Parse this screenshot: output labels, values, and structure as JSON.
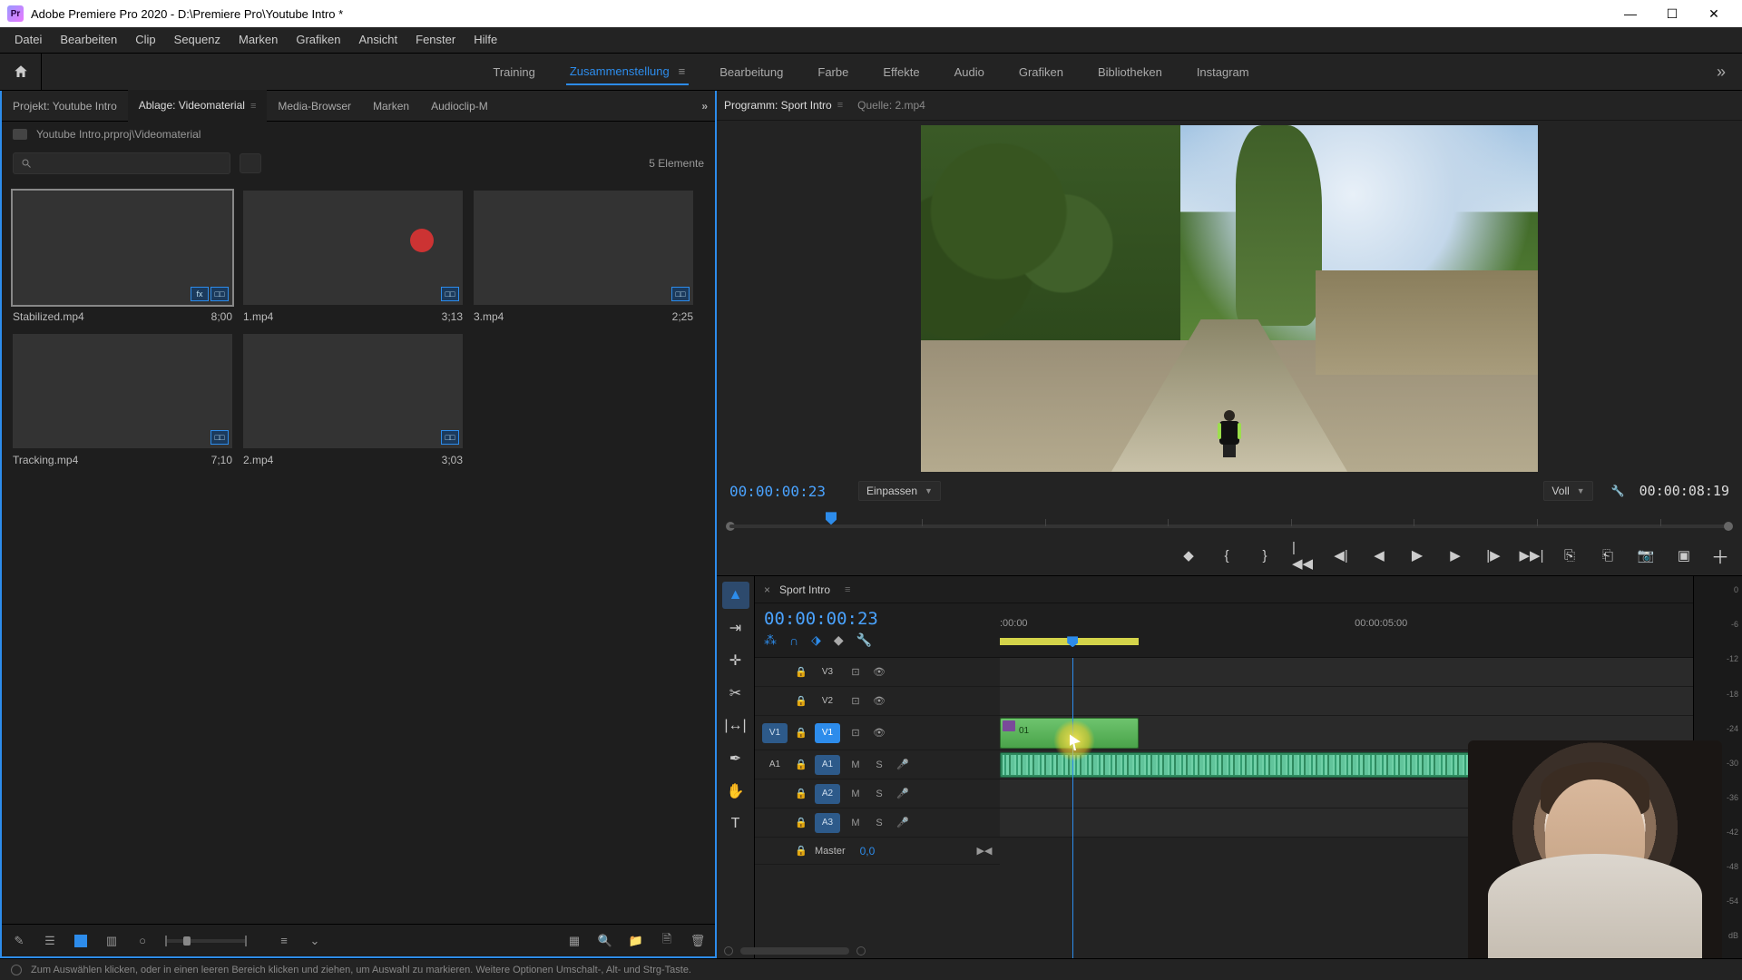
{
  "app": {
    "title": "Adobe Premiere Pro 2020 - D:\\Premiere Pro\\Youtube Intro *"
  },
  "menu": [
    "Datei",
    "Bearbeiten",
    "Clip",
    "Sequenz",
    "Marken",
    "Grafiken",
    "Ansicht",
    "Fenster",
    "Hilfe"
  ],
  "workspaces": {
    "items": [
      "Training",
      "Zusammenstellung",
      "Bearbeitung",
      "Farbe",
      "Effekte",
      "Audio",
      "Grafiken",
      "Bibliotheken",
      "Instagram"
    ],
    "active": 1,
    "more": "»"
  },
  "project": {
    "tabs": {
      "items": [
        "Projekt: Youtube Intro",
        "Ablage: Videomaterial",
        "Media-Browser",
        "Marken",
        "Audioclip-M"
      ],
      "active": 1,
      "overflow": "»"
    },
    "breadcrumb": "Youtube Intro.prproj\\Videomaterial",
    "item_count_label": "5 Elemente",
    "clips": [
      {
        "name": "Stabilized.mp4",
        "dur": "8;00",
        "sel": true,
        "badges": [
          "fx",
          "□□"
        ],
        "img": "img-path"
      },
      {
        "name": "1.mp4",
        "dur": "3;13",
        "sel": false,
        "badges": [
          "□□"
        ],
        "img": "img-wall"
      },
      {
        "name": "3.mp4",
        "dur": "2;25",
        "sel": false,
        "badges": [
          "□□"
        ],
        "img": "img-ground"
      },
      {
        "name": "Tracking.mp4",
        "dur": "7;10",
        "sel": false,
        "badges": [
          "□□"
        ],
        "img": "img-field"
      },
      {
        "name": "2.mp4",
        "dur": "3;03",
        "sel": false,
        "badges": [
          "□□"
        ],
        "img": "img-runner"
      }
    ]
  },
  "program": {
    "tab_label": "Programm: Sport Intro",
    "source_label": "Quelle: 2.mp4",
    "timecode": "00:00:00:23",
    "zoom_label": "Einpassen",
    "quality_label": "Voll",
    "duration": "00:00:08:19"
  },
  "timeline": {
    "seq_name": "Sport Intro",
    "timecode": "00:00:00:23",
    "ruler_labels": [
      {
        "t": ":00:00",
        "x_pct": 2
      },
      {
        "t": "00:00:05:00",
        "x_pct": 55
      }
    ],
    "work_area": {
      "left_pct": 0,
      "width_pct": 20
    },
    "playhead_pct": 10.5,
    "tracks": {
      "video": [
        {
          "src": "",
          "name": "V3",
          "eye": true
        },
        {
          "src": "",
          "name": "V2",
          "eye": true
        },
        {
          "src": "V1",
          "src_on": true,
          "name": "V1",
          "name_on": true,
          "eye": true
        }
      ],
      "audio": [
        {
          "src": "A1",
          "name": "A1",
          "name_on": true,
          "m": "M",
          "s": "S"
        },
        {
          "src": "",
          "name": "A2",
          "name_on": true,
          "m": "M",
          "s": "S"
        },
        {
          "src": "",
          "name": "A3",
          "name_on": true,
          "m": "M",
          "s": "S"
        }
      ],
      "master": {
        "label": "Master",
        "value": "0,0"
      }
    },
    "clips": {
      "video": {
        "left_pct": 0,
        "width_pct": 20,
        "label": "01"
      },
      "audio": {
        "left_pct": 0,
        "width_pct": 84
      }
    }
  },
  "meters": {
    "scale": [
      "0",
      "-6",
      "-12",
      "-18",
      "-24",
      "-30",
      "-36",
      "-42",
      "-48",
      "-54",
      "dB"
    ]
  },
  "status": {
    "text": "Zum Auswählen klicken, oder in einen leeren Bereich klicken und ziehen, um Auswahl zu markieren. Weitere Optionen Umschalt-, Alt- und Strg-Taste."
  },
  "colors": {
    "accent": "#2d8ceb"
  }
}
